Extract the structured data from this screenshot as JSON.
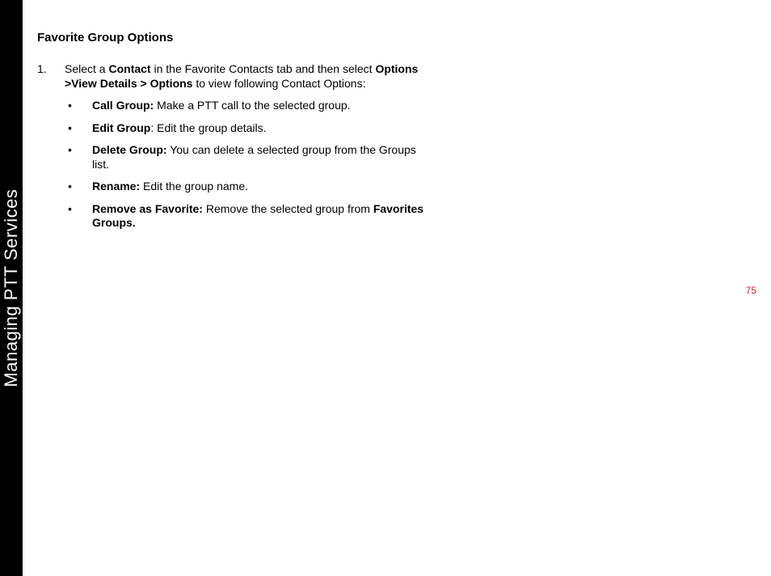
{
  "sidebar": {
    "label": "Managing PTT Services"
  },
  "page": {
    "number": "75"
  },
  "section": {
    "heading": "Favorite Group Options"
  },
  "step": {
    "marker": "1.",
    "text_pre": "Select a ",
    "bold1": "Contact",
    "text_mid1": " in the Favorite Contacts tab and then select ",
    "bold2": "Options >View Details > Options",
    "text_post": " to view following Contact Options:"
  },
  "bullets": [
    {
      "bold": "Call Group:",
      "text": " Make a PTT call to the selected group."
    },
    {
      "bold": "Edit Group",
      "text": ": Edit the group details."
    },
    {
      "bold": "Delete Group:",
      "text": " You can delete a selected group from the Groups list."
    },
    {
      "bold": "Rename:",
      "text": " Edit the group name."
    },
    {
      "bold": "Remove as Favorite:",
      "text_pre": " Remove  the selected group from ",
      "bold2": "Favorites Groups."
    }
  ]
}
